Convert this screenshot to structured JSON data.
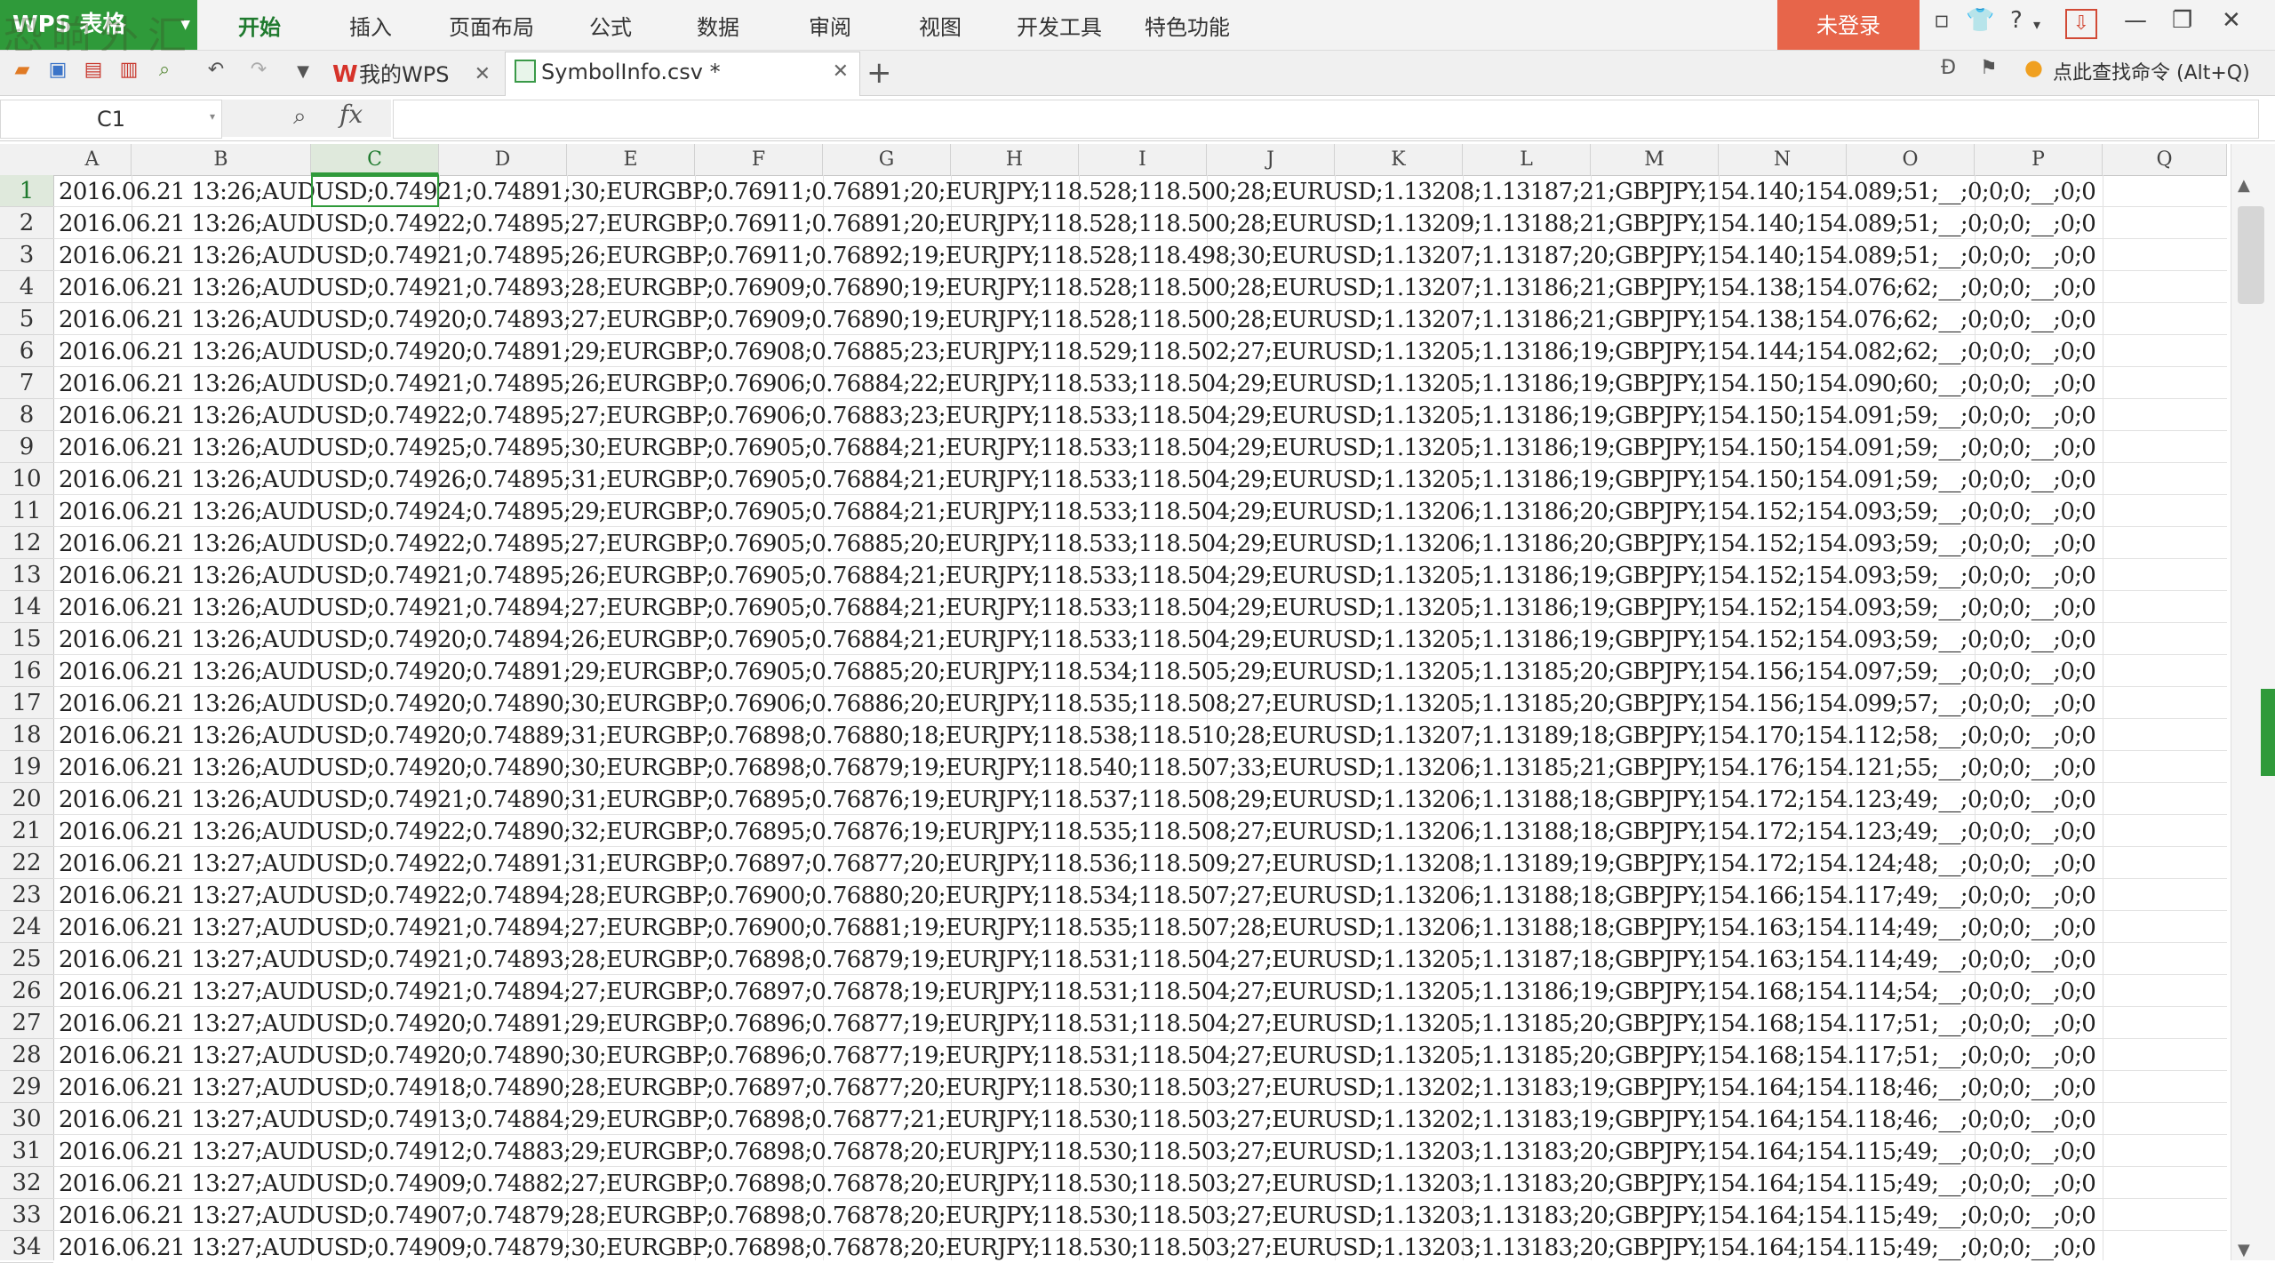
{
  "app": {
    "brand": "WPS 表格",
    "watermark": "恐晌外汇"
  },
  "menu": {
    "items": [
      "开始",
      "插入",
      "页面布局",
      "公式",
      "数据",
      "审阅",
      "视图",
      "开发工具",
      "特色功能"
    ],
    "active": "开始",
    "login": "未登录"
  },
  "tabs": [
    {
      "label": "我的WPS",
      "active": false
    },
    {
      "label": "SymbolInfo.csv *",
      "active": true
    }
  ],
  "toolbar_right": {
    "search_command": "点此查找命令 (Alt+Q)"
  },
  "formula_bar": {
    "name_box": "C1",
    "fx_label": "fx",
    "content": ""
  },
  "columns": [
    "A",
    "B",
    "C",
    "D",
    "E",
    "F",
    "G",
    "H",
    "I",
    "J",
    "K",
    "L",
    "M",
    "N",
    "O",
    "P",
    "Q"
  ],
  "selected_column": "C",
  "selected_row": "1",
  "rows": [
    {
      "n": "1",
      "text": "2016.06.21 13:26;AUDUSD;0.74921;0.74891;30;EURGBP;0.76911;0.76891;20;EURJPY;118.528;118.500;28;EURUSD;1.13208;1.13187;21;GBPJPY;154.140;154.089;51;__;0;0;0;__;0;0"
    },
    {
      "n": "2",
      "text": "2016.06.21 13:26;AUDUSD;0.74922;0.74895;27;EURGBP;0.76911;0.76891;20;EURJPY;118.528;118.500;28;EURUSD;1.13209;1.13188;21;GBPJPY;154.140;154.089;51;__;0;0;0;__;0;0"
    },
    {
      "n": "3",
      "text": "2016.06.21 13:26;AUDUSD;0.74921;0.74895;26;EURGBP;0.76911;0.76892;19;EURJPY;118.528;118.498;30;EURUSD;1.13207;1.13187;20;GBPJPY;154.140;154.089;51;__;0;0;0;__;0;0"
    },
    {
      "n": "4",
      "text": "2016.06.21 13:26;AUDUSD;0.74921;0.74893;28;EURGBP;0.76909;0.76890;19;EURJPY;118.528;118.500;28;EURUSD;1.13207;1.13186;21;GBPJPY;154.138;154.076;62;__;0;0;0;__;0;0"
    },
    {
      "n": "5",
      "text": "2016.06.21 13:26;AUDUSD;0.74920;0.74893;27;EURGBP;0.76909;0.76890;19;EURJPY;118.528;118.500;28;EURUSD;1.13207;1.13186;21;GBPJPY;154.138;154.076;62;__;0;0;0;__;0;0"
    },
    {
      "n": "6",
      "text": "2016.06.21 13:26;AUDUSD;0.74920;0.74891;29;EURGBP;0.76908;0.76885;23;EURJPY;118.529;118.502;27;EURUSD;1.13205;1.13186;19;GBPJPY;154.144;154.082;62;__;0;0;0;__;0;0"
    },
    {
      "n": "7",
      "text": "2016.06.21 13:26;AUDUSD;0.74921;0.74895;26;EURGBP;0.76906;0.76884;22;EURJPY;118.533;118.504;29;EURUSD;1.13205;1.13186;19;GBPJPY;154.150;154.090;60;__;0;0;0;__;0;0"
    },
    {
      "n": "8",
      "text": "2016.06.21 13:26;AUDUSD;0.74922;0.74895;27;EURGBP;0.76906;0.76883;23;EURJPY;118.533;118.504;29;EURUSD;1.13205;1.13186;19;GBPJPY;154.150;154.091;59;__;0;0;0;__;0;0"
    },
    {
      "n": "9",
      "text": "2016.06.21 13:26;AUDUSD;0.74925;0.74895;30;EURGBP;0.76905;0.76884;21;EURJPY;118.533;118.504;29;EURUSD;1.13205;1.13186;19;GBPJPY;154.150;154.091;59;__;0;0;0;__;0;0"
    },
    {
      "n": "10",
      "text": "2016.06.21 13:26;AUDUSD;0.74926;0.74895;31;EURGBP;0.76905;0.76884;21;EURJPY;118.533;118.504;29;EURUSD;1.13205;1.13186;19;GBPJPY;154.150;154.091;59;__;0;0;0;__;0;0"
    },
    {
      "n": "11",
      "text": "2016.06.21 13:26;AUDUSD;0.74924;0.74895;29;EURGBP;0.76905;0.76884;21;EURJPY;118.533;118.504;29;EURUSD;1.13206;1.13186;20;GBPJPY;154.152;154.093;59;__;0;0;0;__;0;0"
    },
    {
      "n": "12",
      "text": "2016.06.21 13:26;AUDUSD;0.74922;0.74895;27;EURGBP;0.76905;0.76885;20;EURJPY;118.533;118.504;29;EURUSD;1.13206;1.13186;20;GBPJPY;154.152;154.093;59;__;0;0;0;__;0;0"
    },
    {
      "n": "13",
      "text": "2016.06.21 13:26;AUDUSD;0.74921;0.74895;26;EURGBP;0.76905;0.76884;21;EURJPY;118.533;118.504;29;EURUSD;1.13205;1.13186;19;GBPJPY;154.152;154.093;59;__;0;0;0;__;0;0"
    },
    {
      "n": "14",
      "text": "2016.06.21 13:26;AUDUSD;0.74921;0.74894;27;EURGBP;0.76905;0.76884;21;EURJPY;118.533;118.504;29;EURUSD;1.13205;1.13186;19;GBPJPY;154.152;154.093;59;__;0;0;0;__;0;0"
    },
    {
      "n": "15",
      "text": "2016.06.21 13:26;AUDUSD;0.74920;0.74894;26;EURGBP;0.76905;0.76884;21;EURJPY;118.533;118.504;29;EURUSD;1.13205;1.13186;19;GBPJPY;154.152;154.093;59;__;0;0;0;__;0;0"
    },
    {
      "n": "16",
      "text": "2016.06.21 13:26;AUDUSD;0.74920;0.74891;29;EURGBP;0.76905;0.76885;20;EURJPY;118.534;118.505;29;EURUSD;1.13205;1.13185;20;GBPJPY;154.156;154.097;59;__;0;0;0;__;0;0"
    },
    {
      "n": "17",
      "text": "2016.06.21 13:26;AUDUSD;0.74920;0.74890;30;EURGBP;0.76906;0.76886;20;EURJPY;118.535;118.508;27;EURUSD;1.13205;1.13185;20;GBPJPY;154.156;154.099;57;__;0;0;0;__;0;0"
    },
    {
      "n": "18",
      "text": "2016.06.21 13:26;AUDUSD;0.74920;0.74889;31;EURGBP;0.76898;0.76880;18;EURJPY;118.538;118.510;28;EURUSD;1.13207;1.13189;18;GBPJPY;154.170;154.112;58;__;0;0;0;__;0;0"
    },
    {
      "n": "19",
      "text": "2016.06.21 13:26;AUDUSD;0.74920;0.74890;30;EURGBP;0.76898;0.76879;19;EURJPY;118.540;118.507;33;EURUSD;1.13206;1.13185;21;GBPJPY;154.176;154.121;55;__;0;0;0;__;0;0"
    },
    {
      "n": "20",
      "text": "2016.06.21 13:26;AUDUSD;0.74921;0.74890;31;EURGBP;0.76895;0.76876;19;EURJPY;118.537;118.508;29;EURUSD;1.13206;1.13188;18;GBPJPY;154.172;154.123;49;__;0;0;0;__;0;0"
    },
    {
      "n": "21",
      "text": "2016.06.21 13:26;AUDUSD;0.74922;0.74890;32;EURGBP;0.76895;0.76876;19;EURJPY;118.535;118.508;27;EURUSD;1.13206;1.13188;18;GBPJPY;154.172;154.123;49;__;0;0;0;__;0;0"
    },
    {
      "n": "22",
      "text": "2016.06.21 13:27;AUDUSD;0.74922;0.74891;31;EURGBP;0.76897;0.76877;20;EURJPY;118.536;118.509;27;EURUSD;1.13208;1.13189;19;GBPJPY;154.172;154.124;48;__;0;0;0;__;0;0"
    },
    {
      "n": "23",
      "text": "2016.06.21 13:27;AUDUSD;0.74922;0.74894;28;EURGBP;0.76900;0.76880;20;EURJPY;118.534;118.507;27;EURUSD;1.13206;1.13188;18;GBPJPY;154.166;154.117;49;__;0;0;0;__;0;0"
    },
    {
      "n": "24",
      "text": "2016.06.21 13:27;AUDUSD;0.74921;0.74894;27;EURGBP;0.76900;0.76881;19;EURJPY;118.535;118.507;28;EURUSD;1.13206;1.13188;18;GBPJPY;154.163;154.114;49;__;0;0;0;__;0;0"
    },
    {
      "n": "25",
      "text": "2016.06.21 13:27;AUDUSD;0.74921;0.74893;28;EURGBP;0.76898;0.76879;19;EURJPY;118.531;118.504;27;EURUSD;1.13205;1.13187;18;GBPJPY;154.163;154.114;49;__;0;0;0;__;0;0"
    },
    {
      "n": "26",
      "text": "2016.06.21 13:27;AUDUSD;0.74921;0.74894;27;EURGBP;0.76897;0.76878;19;EURJPY;118.531;118.504;27;EURUSD;1.13205;1.13186;19;GBPJPY;154.168;154.114;54;__;0;0;0;__;0;0"
    },
    {
      "n": "27",
      "text": "2016.06.21 13:27;AUDUSD;0.74920;0.74891;29;EURGBP;0.76896;0.76877;19;EURJPY;118.531;118.504;27;EURUSD;1.13205;1.13185;20;GBPJPY;154.168;154.117;51;__;0;0;0;__;0;0"
    },
    {
      "n": "28",
      "text": "2016.06.21 13:27;AUDUSD;0.74920;0.74890;30;EURGBP;0.76896;0.76877;19;EURJPY;118.531;118.504;27;EURUSD;1.13205;1.13185;20;GBPJPY;154.168;154.117;51;__;0;0;0;__;0;0"
    },
    {
      "n": "29",
      "text": "2016.06.21 13:27;AUDUSD;0.74918;0.74890;28;EURGBP;0.76897;0.76877;20;EURJPY;118.530;118.503;27;EURUSD;1.13202;1.13183;19;GBPJPY;154.164;154.118;46;__;0;0;0;__;0;0"
    },
    {
      "n": "30",
      "text": "2016.06.21 13:27;AUDUSD;0.74913;0.74884;29;EURGBP;0.76898;0.76877;21;EURJPY;118.530;118.503;27;EURUSD;1.13202;1.13183;19;GBPJPY;154.164;154.118;46;__;0;0;0;__;0;0"
    },
    {
      "n": "31",
      "text": "2016.06.21 13:27;AUDUSD;0.74912;0.74883;29;EURGBP;0.76898;0.76878;20;EURJPY;118.530;118.503;27;EURUSD;1.13203;1.13183;20;GBPJPY;154.164;154.115;49;__;0;0;0;__;0;0"
    },
    {
      "n": "32",
      "text": "2016.06.21 13:27;AUDUSD;0.74909;0.74882;27;EURGBP;0.76898;0.76878;20;EURJPY;118.530;118.503;27;EURUSD;1.13203;1.13183;20;GBPJPY;154.164;154.115;49;__;0;0;0;__;0;0"
    },
    {
      "n": "33",
      "text": "2016.06.21 13:27;AUDUSD;0.74907;0.74879;28;EURGBP;0.76898;0.76878;20;EURJPY;118.530;118.503;27;EURUSD;1.13203;1.13183;20;GBPJPY;154.164;154.115;49;__;0;0;0;__;0;0"
    },
    {
      "n": "34",
      "text": "2016.06.21 13:27;AUDUSD;0.74909;0.74879;30;EURGBP;0.76898;0.76878;20;EURJPY;118.530;118.503;27;EURUSD;1.13203;1.13183;20;GBPJPY;154.164;154.115;49;__;0;0;0;__;0;0"
    }
  ],
  "colors": {
    "accent": "#2f9a3a",
    "login_button": "#e7654a"
  }
}
